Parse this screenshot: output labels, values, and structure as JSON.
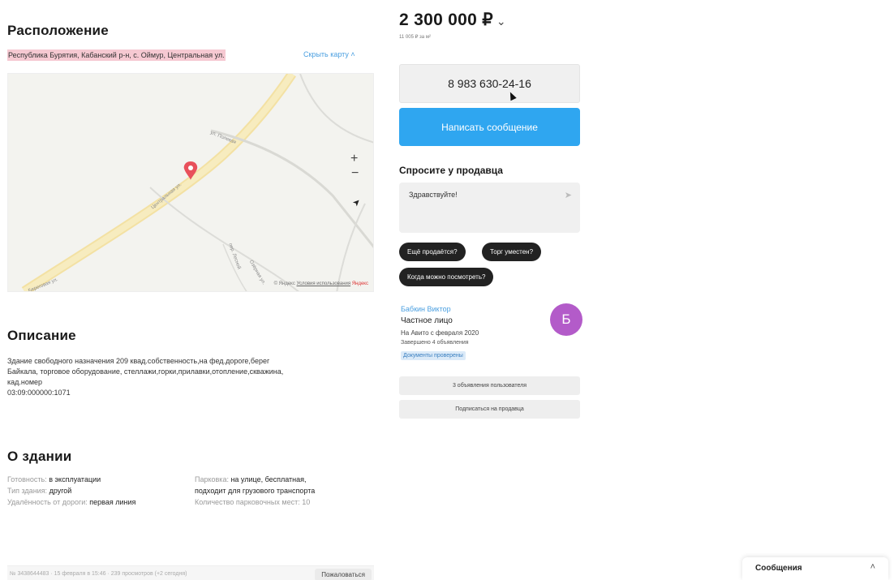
{
  "location": {
    "heading": "Расположение",
    "address": "Республика Бурятия, Кабанский р-н, с. Оймур, Центральная ул.",
    "hide_map": "Скрыть карту ˄"
  },
  "map": {
    "zoom_in": "+",
    "zoom_out": "−",
    "nav_arrow": "➤",
    "road_labels": {
      "main": "Центральная ул.",
      "top": "ул. Полевая",
      "bottom_left": "Береговая ул.",
      "bottom_right": "Озёрная ул.",
      "mid": "пер. Лесной"
    },
    "copyright": "© Яндекс",
    "terms": "Условия использования",
    "brand": "Яндекс"
  },
  "description": {
    "heading": "Описание",
    "lines": [
      "Здание свободного назначения 209 квад.собственность,на фед.дороге,берег",
      "Байкала, торговое оборудование, стеллажи,горки,прилавки,отопление,скважина,",
      "кад.номер",
      "03:09:000000:1071"
    ]
  },
  "about": {
    "heading": "О здании",
    "left": [
      {
        "label": "Готовность: ",
        "value": "в эксплуатации"
      },
      {
        "label": "Тип здания: ",
        "value": "другой"
      },
      {
        "label": "Удалённость от дороги: ",
        "value": "первая линия"
      }
    ],
    "right": {
      "parking_label": "Парковка: ",
      "parking_value_1": "на улице, бесплатная,",
      "parking_value_2": "подходит для грузового транспорта",
      "spots_label": "Количество парковочных мест: ",
      "spots_value": "10"
    }
  },
  "footer": {
    "meta": "№ 3438644483 · 15 февраля в 15:46 · 239 просмотров (+2 сегодня)",
    "complain": "Пожаловаться"
  },
  "price": {
    "value": "2 300 000 ₽",
    "chevron": "⌄",
    "per_m2": "11 005 ₽ за м²"
  },
  "phone": "8 983 630-24-16",
  "write_message": "Написать сообщение",
  "ask": {
    "title": "Спросите у продавца",
    "text": "Здравствуйте!",
    "send_icon": "➤",
    "chips": [
      "Ещё продаётся?",
      "Торг уместен?",
      "Когда можно посмотреть?"
    ]
  },
  "seller": {
    "name": "Бабкин Виктор",
    "type": "Частное лицо",
    "since": "На Авито с февраля 2020",
    "done": "Завершено 4 объявления",
    "badge": "Документы проверены",
    "avatar_letter": "Б",
    "avatar_color": "#b35bc9",
    "listings_btn": "3 объявления пользователя",
    "subscribe_btn": "Подписаться на продавца"
  },
  "messages_panel": {
    "title": "Сообщения",
    "chevron": "˄"
  },
  "colors": {
    "accent": "#2fa6f0",
    "address_highlight": "#f6c9d2",
    "pin": "#e8505b"
  }
}
